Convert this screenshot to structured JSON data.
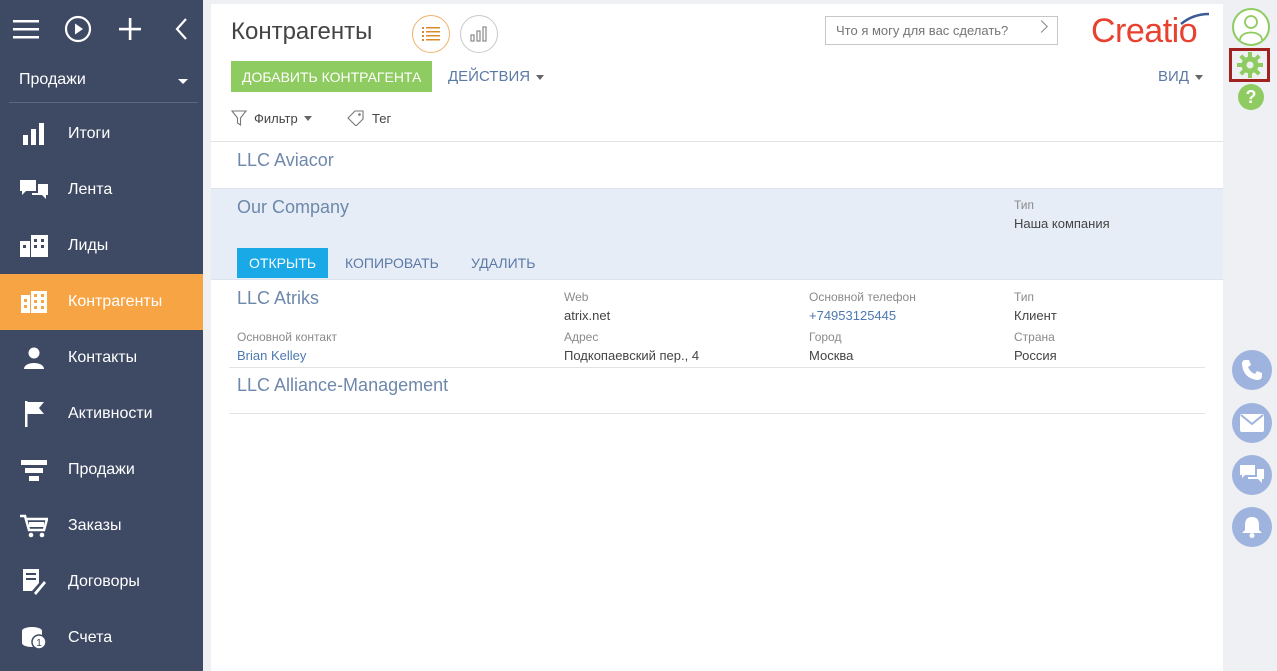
{
  "sidebar": {
    "section": "Продажи",
    "items": [
      {
        "label": "Итоги",
        "icon": "bar-chart-icon"
      },
      {
        "label": "Лента",
        "icon": "chat-bubbles-icon"
      },
      {
        "label": "Лиды",
        "icon": "leads-icon"
      },
      {
        "label": "Контрагенты",
        "icon": "building-icon",
        "active": true
      },
      {
        "label": "Контакты",
        "icon": "person-icon"
      },
      {
        "label": "Активности",
        "icon": "flag-icon"
      },
      {
        "label": "Продажи",
        "icon": "funnel-icon"
      },
      {
        "label": "Заказы",
        "icon": "cart-icon"
      },
      {
        "label": "Договоры",
        "icon": "contract-icon"
      },
      {
        "label": "Счета",
        "icon": "coins-icon"
      }
    ]
  },
  "header": {
    "title": "Контрагенты",
    "command_placeholder": "Что я могу для вас сделать?",
    "logo": "Creatio",
    "add_label": "ДОБАВИТЬ КОНТРАГЕНТА",
    "actions_label": "ДЕЙСТВИЯ",
    "view_label": "ВИД",
    "filter_label": "Фильтр",
    "tag_label": "Тег"
  },
  "rows": {
    "aviacor": {
      "name": "LLC Aviacor"
    },
    "ourcompany": {
      "name": "Our Company",
      "type_caption": "Тип",
      "type_value": "Наша компания",
      "open_label": "ОТКРЫТЬ",
      "copy_label": "КОПИРОВАТЬ",
      "delete_label": "УДАЛИТЬ"
    },
    "atriks": {
      "name": "LLC Atriks",
      "web_caption": "Web",
      "web_value": "atrix.net",
      "phone_caption": "Основной телефон",
      "phone_value": "+74953125445",
      "type_caption": "Тип",
      "type_value": "Клиент",
      "contact_caption": "Основной контакт",
      "contact_value": "Brian Kelley",
      "address_caption": "Адрес",
      "address_value": "Подкопаевский пер., 4",
      "city_caption": "Город",
      "city_value": "Москва",
      "country_caption": "Страна",
      "country_value": "Россия"
    },
    "alliance": {
      "name": "LLC Alliance-Management"
    }
  },
  "colors": {
    "sidebar_bg": "#3e4a64",
    "active_item": "#f7a444",
    "add_button": "#8ecb60",
    "open_button": "#18a9e6",
    "selected_row": "#e6edf7",
    "logo": "#e8412f"
  }
}
